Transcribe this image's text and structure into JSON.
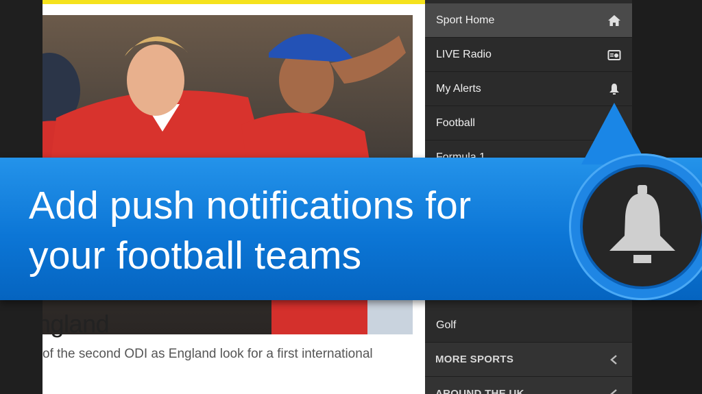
{
  "article": {
    "headline": "ngland",
    "summary": "of the second ODI as England look for a first international",
    "photo_description_icon": "cricket-celebration-photo"
  },
  "menu": {
    "items": [
      {
        "label": "Sport Home",
        "icon": "home-icon",
        "active": true
      },
      {
        "label": "LIVE Radio",
        "icon": "radio-icon",
        "active": false
      },
      {
        "label": "My Alerts",
        "icon": "bell-icon",
        "active": false
      },
      {
        "label": "Football",
        "icon": "",
        "active": false
      },
      {
        "label": "Formula 1",
        "icon": "",
        "active": false
      }
    ],
    "lower_items": [
      {
        "label": "Golf"
      }
    ],
    "sections": [
      {
        "label": "MORE SPORTS",
        "icon": "chevron-left-icon"
      },
      {
        "label": "AROUND THE UK",
        "icon": "chevron-left-icon"
      }
    ]
  },
  "banner": {
    "text": "Add push notifications for your football teams",
    "badge_icon": "bell-icon"
  },
  "colors": {
    "banner_blue": "#0c76d6",
    "accent_yellow": "#f5e21c",
    "menu_bg": "#2b2b2b"
  }
}
